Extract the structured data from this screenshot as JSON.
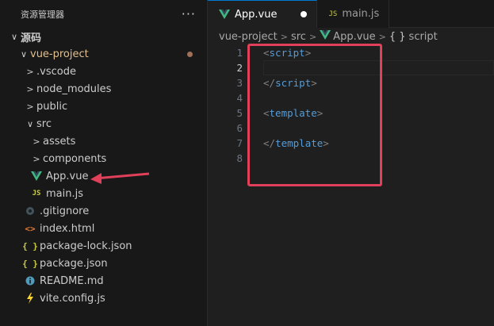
{
  "sidebar": {
    "title": "资源管理器",
    "more": "···",
    "tree": [
      {
        "label": "源码",
        "chevron": "∨",
        "indent": 10,
        "bold": true,
        "icon": ""
      },
      {
        "label": "vue-project",
        "chevron": "∨",
        "indent": 22,
        "icon": "",
        "modified": true,
        "orange": true
      },
      {
        "label": ".vscode",
        "chevron": ">",
        "indent": 30,
        "icon": ""
      },
      {
        "label": "node_modules",
        "chevron": ">",
        "indent": 30,
        "icon": ""
      },
      {
        "label": "public",
        "chevron": ">",
        "indent": 30,
        "icon": ""
      },
      {
        "label": "src",
        "chevron": "∨",
        "indent": 30,
        "icon": ""
      },
      {
        "label": "assets",
        "chevron": ">",
        "indent": 38,
        "icon": ""
      },
      {
        "label": "components",
        "chevron": ">",
        "indent": 38,
        "icon": ""
      },
      {
        "label": "App.vue",
        "chevron": "",
        "indent": 38,
        "icon": "vue-icon"
      },
      {
        "label": "main.js",
        "chevron": "",
        "indent": 38,
        "icon": "js-icon"
      },
      {
        "label": ".gitignore",
        "chevron": "",
        "indent": 30,
        "icon": "git-icon"
      },
      {
        "label": "index.html",
        "chevron": "",
        "indent": 30,
        "icon": "html-icon"
      },
      {
        "label": "package-lock.json",
        "chevron": "",
        "indent": 30,
        "icon": "json-icon"
      },
      {
        "label": "package.json",
        "chevron": "",
        "indent": 30,
        "icon": "json-icon"
      },
      {
        "label": "README.md",
        "chevron": "",
        "indent": 30,
        "icon": "info-icon"
      },
      {
        "label": "vite.config.js",
        "chevron": "",
        "indent": 30,
        "icon": "vite-icon"
      }
    ]
  },
  "tabs": [
    {
      "label": "App.vue",
      "icon": "vue-icon",
      "active": true,
      "dirty": true
    },
    {
      "label": "main.js",
      "icon": "js-icon",
      "active": false,
      "dirty": false
    }
  ],
  "icon_text": {
    "js": "JS",
    "json": "{ }",
    "html": "<>"
  },
  "breadcrumb": [
    {
      "label": "vue-project"
    },
    {
      "label": "src"
    },
    {
      "label": "App.vue",
      "icon": "vue-icon"
    },
    {
      "label": "script",
      "icon": "braces-icon",
      "icon_text": "{ }"
    }
  ],
  "breadcrumb_sep": ">",
  "code_lines": [
    {
      "n": "1",
      "open": "<",
      "tag": "script",
      "close": ">"
    },
    {
      "n": "2",
      "open": "",
      "tag": "",
      "close": "",
      "current": true
    },
    {
      "n": "3",
      "open": "</",
      "tag": "script",
      "close": ">"
    },
    {
      "n": "4",
      "open": "",
      "tag": "",
      "close": ""
    },
    {
      "n": "5",
      "open": "<",
      "tag": "template",
      "close": ">"
    },
    {
      "n": "6",
      "open": "",
      "tag": "",
      "close": ""
    },
    {
      "n": "7",
      "open": "</",
      "tag": "template",
      "close": ">"
    },
    {
      "n": "8",
      "open": "",
      "tag": "",
      "close": ""
    }
  ],
  "colors": {
    "accent": "#0078d4",
    "annotation": "#e0405a",
    "vue_green": "#41b883",
    "js_yellow": "#cbcb41",
    "tag_blue": "#569cd6"
  }
}
